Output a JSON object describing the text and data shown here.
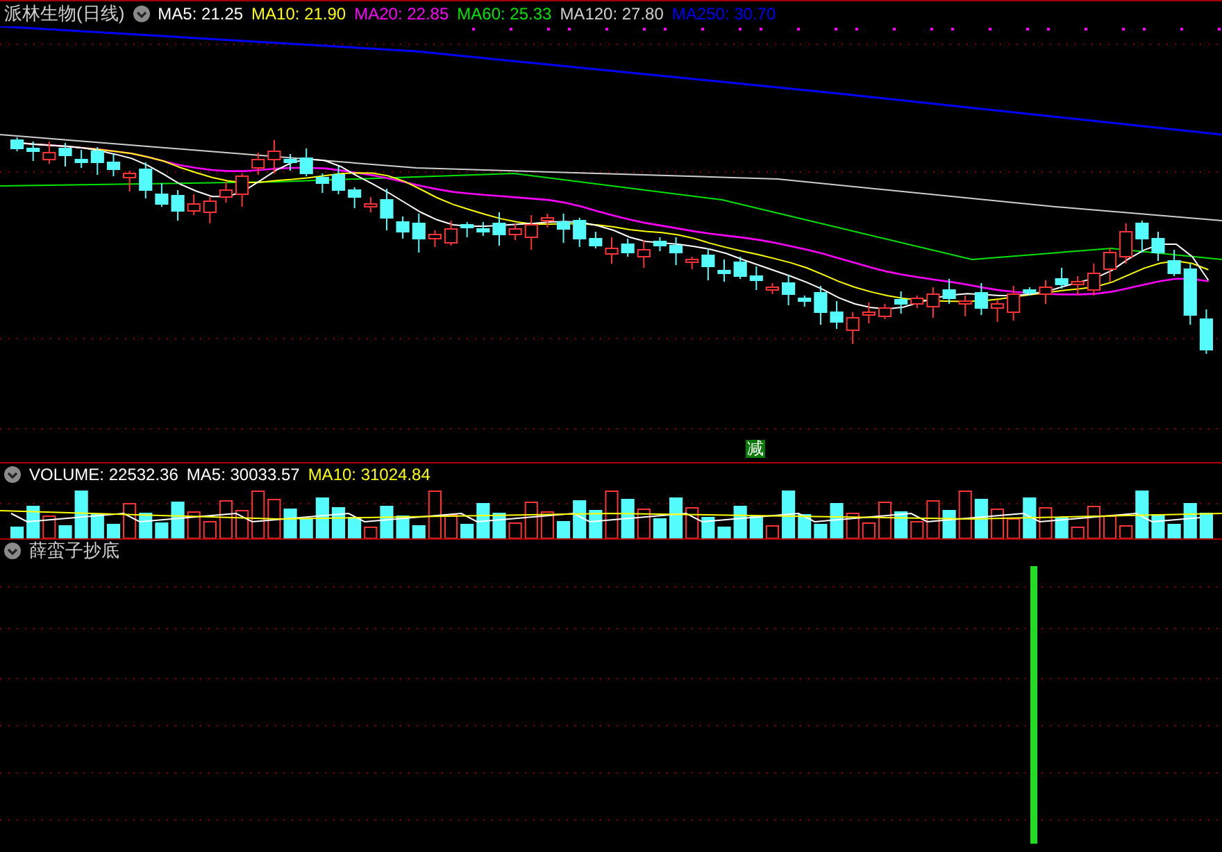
{
  "main_panel": {
    "title": "派林生物(日线)",
    "legend": [
      {
        "label": "MA5: 21.25",
        "color": "#ffffff"
      },
      {
        "label": "MA10: 21.90",
        "color": "#ffff00"
      },
      {
        "label": "MA20: 22.85",
        "color": "#ff00ff"
      },
      {
        "label": "MA60: 25.33",
        "color": "#00e600"
      },
      {
        "label": "MA120: 27.80",
        "color": "#d0d0d0"
      },
      {
        "label": "MA250: 30.70",
        "color": "#0000ff"
      }
    ],
    "marker": {
      "text": "减"
    }
  },
  "volume_panel": {
    "legend": [
      {
        "label": "VOLUME: 22532.36",
        "color": "#ffffff"
      },
      {
        "label": "MA5: 30033.57",
        "color": "#ffffff"
      },
      {
        "label": "MA10: 31024.84",
        "color": "#ffff00"
      }
    ]
  },
  "indicator_panel": {
    "title": "薛蛮子抄底"
  }
}
